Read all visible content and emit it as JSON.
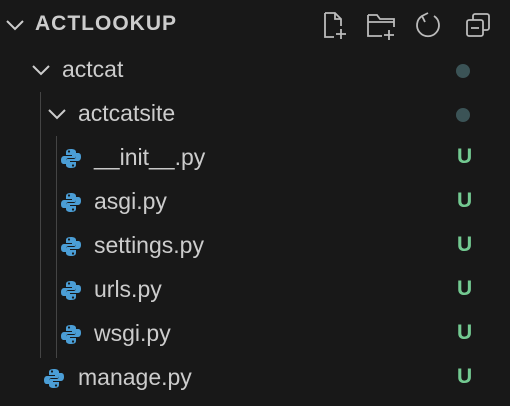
{
  "explorer": {
    "section_title": "ACTLOOKUP",
    "actions": [
      {
        "name": "new-file-icon"
      },
      {
        "name": "new-folder-icon"
      },
      {
        "name": "refresh-icon"
      },
      {
        "name": "collapse-all-icon"
      }
    ]
  },
  "tree": {
    "folder_actcat": "actcat",
    "folder_actcatsite": "actcatsite",
    "files": [
      {
        "label": "__init__.py",
        "status": "U"
      },
      {
        "label": "asgi.py",
        "status": "U"
      },
      {
        "label": "settings.py",
        "status": "U"
      },
      {
        "label": "urls.py",
        "status": "U"
      },
      {
        "label": "wsgi.py",
        "status": "U"
      }
    ],
    "manage": {
      "label": "manage.py",
      "status": "U"
    }
  },
  "colors": {
    "background": "#181818",
    "text": "#cccccc",
    "untracked": "#73c991",
    "python_icon": "#4b9ed6",
    "modified_dot": "#3b5356"
  }
}
